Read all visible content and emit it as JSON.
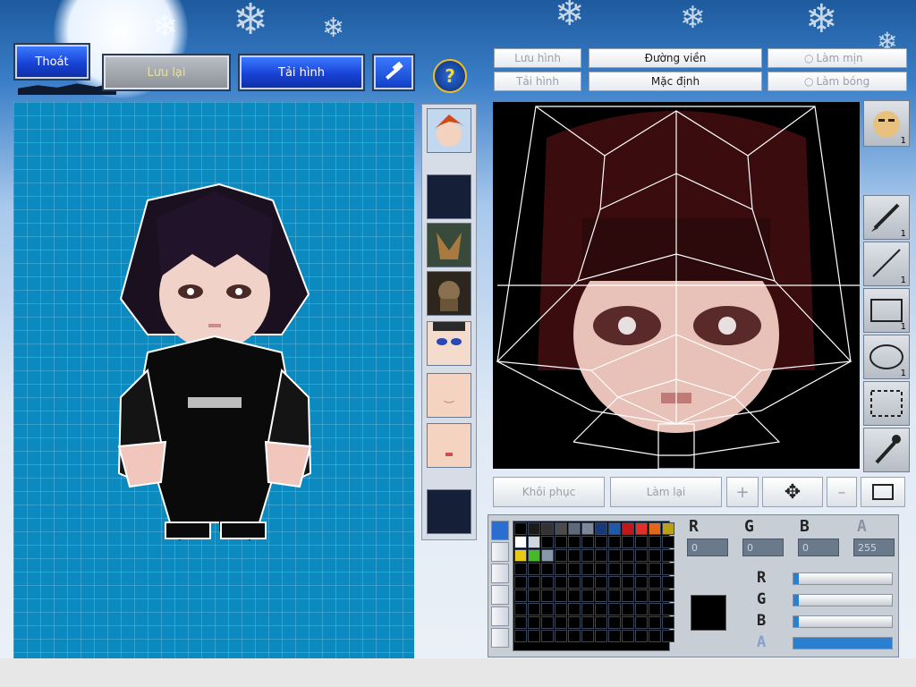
{
  "colors": {
    "accent_blue": "#1843d6",
    "canvas_bg": "#0b8ac0",
    "editor_bg": "#000000",
    "selected_color": "#000000"
  },
  "top_left": {
    "exit_label": "Thoát",
    "save_label": "Lưu lại",
    "reload_label": "Tải hình",
    "hammer_icon": "hammer-icon"
  },
  "editor_controls": {
    "help_label": "?",
    "save_image_label": "Lưu hình",
    "load_image_label": "Tải hình",
    "outline_label": "Đường viền",
    "default_label": "Mặc định",
    "smooth_label": "Làm mịn",
    "shadow_label": "Làm bóng"
  },
  "strip_parts": [
    {
      "name": "hair-part",
      "icon": "redhead-face"
    },
    {
      "name": "empty-part-1",
      "icon": "empty"
    },
    {
      "name": "helmet-part",
      "icon": "helmet"
    },
    {
      "name": "armor-part",
      "icon": "armor"
    },
    {
      "name": "eyes-part",
      "icon": "blue-eyes-face"
    },
    {
      "name": "skin-part",
      "icon": "skin"
    },
    {
      "name": "mouth-part",
      "icon": "mouth-face"
    },
    {
      "name": "empty-part-2",
      "icon": "empty"
    }
  ],
  "tools": [
    {
      "name": "face-tool",
      "count": "1"
    },
    {
      "name": "brush-tool",
      "count": "1"
    },
    {
      "name": "line-tool",
      "count": "1"
    },
    {
      "name": "rect-tool",
      "count": "1"
    },
    {
      "name": "ellipse-tool",
      "count": "1"
    },
    {
      "name": "select-tool",
      "count": ""
    },
    {
      "name": "eyedropper-tool",
      "count": ""
    }
  ],
  "bottom_bar": {
    "restore_label": "Khôi phục",
    "redo_label": "Làm lại",
    "plus_label": "+",
    "minus_label": "–"
  },
  "channels": {
    "r_label": "R",
    "g_label": "G",
    "b_label": "B",
    "a_label": "A",
    "r_value": "0",
    "g_value": "0",
    "b_value": "0",
    "a_value": "255"
  },
  "sliders": [
    {
      "label": "R",
      "fill": 0.05
    },
    {
      "label": "G",
      "fill": 0.05
    },
    {
      "label": "B",
      "fill": 0.05
    },
    {
      "label": "A",
      "fill": 1.0
    }
  ],
  "palette_first_row": [
    "#000000",
    "#1b1b1b",
    "#333333",
    "#4b4b4b",
    "#5e6a78",
    "#7a8898",
    "#183a78",
    "#1e5aa8",
    "#c01818",
    "#e03028",
    "#e06818",
    "#b8a018"
  ],
  "palette_second_row": [
    "#ffffff",
    "#cfd6de",
    "#000000",
    "#000000",
    "#000000",
    "#000000",
    "#000000",
    "#000000",
    "#000000",
    "#000000",
    "#000000",
    "#000000"
  ],
  "palette_third_row": [
    "#e8c818",
    "#48b828",
    "#8898a8",
    "#000000",
    "#000000",
    "#000000",
    "#000000",
    "#000000",
    "#000000",
    "#000000",
    "#000000",
    "#000000"
  ]
}
